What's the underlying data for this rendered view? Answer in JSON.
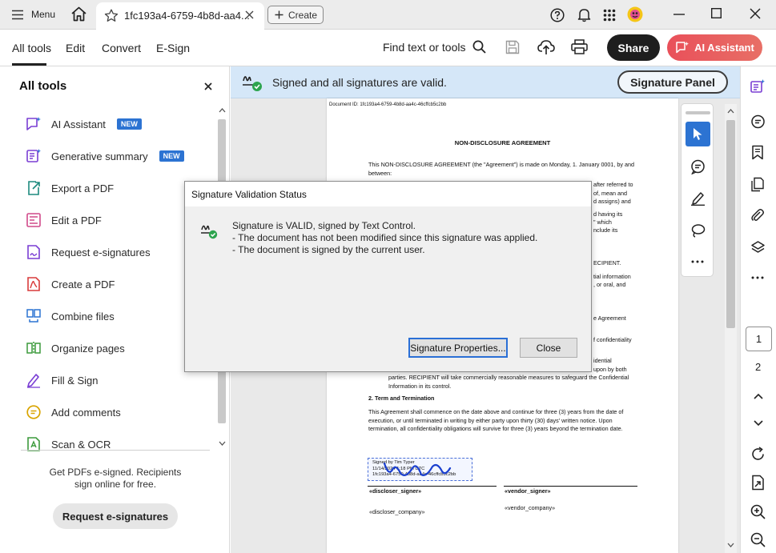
{
  "topbar": {
    "menu_label": "Menu",
    "tab_title": "1fc193a4-6759-4b8d-aa4...",
    "create_label": "Create"
  },
  "toolbar": {
    "tabs": [
      "All tools",
      "Edit",
      "Convert",
      "E-Sign"
    ],
    "find_label": "Find text or tools",
    "share_label": "Share",
    "ai_label": "AI Assistant"
  },
  "left_panel": {
    "title": "All tools",
    "items": [
      {
        "label": "AI Assistant",
        "badge": "NEW",
        "icon": "ai-assistant-icon"
      },
      {
        "label": "Generative summary",
        "badge": "NEW",
        "icon": "generative-summary-icon"
      },
      {
        "label": "Export a PDF",
        "icon": "export-pdf-icon"
      },
      {
        "label": "Edit a PDF",
        "icon": "edit-pdf-icon"
      },
      {
        "label": "Request e-signatures",
        "icon": "request-esign-icon"
      },
      {
        "label": "Create a PDF",
        "icon": "create-pdf-icon"
      },
      {
        "label": "Combine files",
        "icon": "combine-files-icon"
      },
      {
        "label": "Organize pages",
        "icon": "organize-pages-icon"
      },
      {
        "label": "Fill & Sign",
        "icon": "fill-sign-icon"
      },
      {
        "label": "Add comments",
        "icon": "add-comments-icon"
      },
      {
        "label": "Scan & OCR",
        "icon": "scan-ocr-icon"
      }
    ],
    "promo_text": "Get PDFs e-signed. Recipients sign online for free.",
    "promo_button": "Request e-signatures"
  },
  "signature_bar": {
    "status": "Signed and all signatures are valid.",
    "panel_button": "Signature Panel"
  },
  "document": {
    "doc_id": "Document ID: 1fc193a4-6759-4b8d-aa4c-46cffcb5c2bb",
    "title": "NON-DISCLOSURE AGREEMENT",
    "intro": "This NON-DISCLOSURE AGREEMENT (the \"Agreement\") is made on Monday, 1. January 0001, by and between:",
    "frag1": "after referred to",
    "frag2": "of, mean and",
    "frag3": "d assigns) and",
    "frag4": "d having its",
    "frag5": "\" which",
    "frag6": "nclude its",
    "frag7": "ECIPIENT.",
    "frag8": "tial information",
    "frag9": ", or oral, and",
    "frag10": "e Agreement",
    "frag11": "f confidentiality",
    "frag12": "idential",
    "frag13": "upon by both",
    "para_tail": "parties. RECIPIENT will take commercially reasonable measures to safeguard the Confidential Information in its control.",
    "section2_title": "2. Term and Termination",
    "section2_text": "This Agreement shall commence on the date above and continue for three (3) years from the date of execution, or until terminated in writing by either party upon thirty (30) days' written notice. Upon termination, all confidentiality obligations will survive for three (3) years beyond the termination date.",
    "sig_line1": "Signed by Tim Typer",
    "sig_line2": "11/14/2024 1:18 PM UTC",
    "sig_line3": "1fc193a4-6759-4b8d-aa4c-46cffcb5c2bb",
    "discloser_signer": "«discloser_signer»",
    "vendor_signer": "«vendor_signer»",
    "discloser_company": "«discloser_company»",
    "vendor_company": "«vendor_company»"
  },
  "page_nav": {
    "current_page": "1",
    "next_page": "2"
  },
  "dialog": {
    "title": "Signature Validation Status",
    "line1": "Signature is VALID, signed by Text Control.",
    "line2": "- The document has not been modified since this signature was applied.",
    "line3": "- The document is signed by the current user.",
    "properties_button": "Signature Properties...",
    "close_button": "Close"
  },
  "colors": {
    "ai_gradient_start": "#e9505a",
    "new_badge": "#2c73d2",
    "sig_bar": "#d5e7f8",
    "select_tool": "#2c73d2",
    "valid_green": "#2da44e"
  }
}
